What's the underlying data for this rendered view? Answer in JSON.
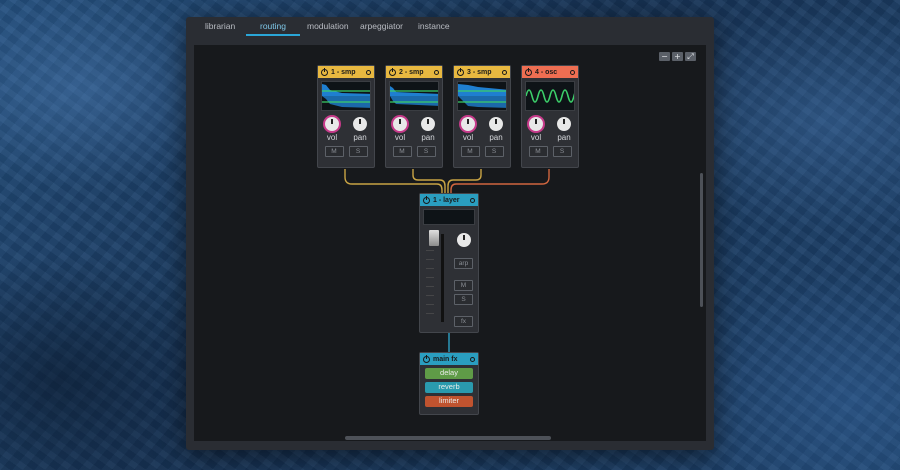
{
  "tabs": [
    {
      "label": "librarian",
      "active": false
    },
    {
      "label": "routing",
      "active": true
    },
    {
      "label": "modulation",
      "active": false
    },
    {
      "label": "arpeggiator",
      "active": false
    },
    {
      "label": "instance",
      "active": false
    }
  ],
  "zoom": {
    "out_icon": "minus-icon",
    "in_icon": "plus-icon",
    "fit_icon": "expand-icon"
  },
  "modules": [
    {
      "label": "1 - smp",
      "color": "#e8b840",
      "wave": "sample",
      "vol_label": "vol",
      "pan_label": "pan",
      "mute": "M",
      "solo": "S"
    },
    {
      "label": "2 - smp",
      "color": "#e8b840",
      "wave": "sample",
      "vol_label": "vol",
      "pan_label": "pan",
      "mute": "M",
      "solo": "S"
    },
    {
      "label": "3 - smp",
      "color": "#e8b840",
      "wave": "sample",
      "vol_label": "vol",
      "pan_label": "pan",
      "mute": "M",
      "solo": "S"
    },
    {
      "label": "4 - osc",
      "color": "#ee6e52",
      "wave": "sine",
      "vol_label": "vol",
      "pan_label": "pan",
      "mute": "M",
      "solo": "S"
    }
  ],
  "layer": {
    "label": "1 - layer",
    "color": "#2a9ec0",
    "arp": "arp",
    "mute": "M",
    "solo": "S",
    "fx": "fx"
  },
  "main_fx": {
    "label": "main fx",
    "color": "#2a9ec0",
    "items": [
      {
        "label": "delay",
        "color": "#5f9b47"
      },
      {
        "label": "reverb",
        "color": "#2a9aae"
      },
      {
        "label": "limiter",
        "color": "#c0532f"
      }
    ]
  },
  "colors": {
    "accent": "#2aa6d8",
    "sample": "#e8b840",
    "osc": "#ee6e52",
    "layer": "#2a9ec0"
  }
}
